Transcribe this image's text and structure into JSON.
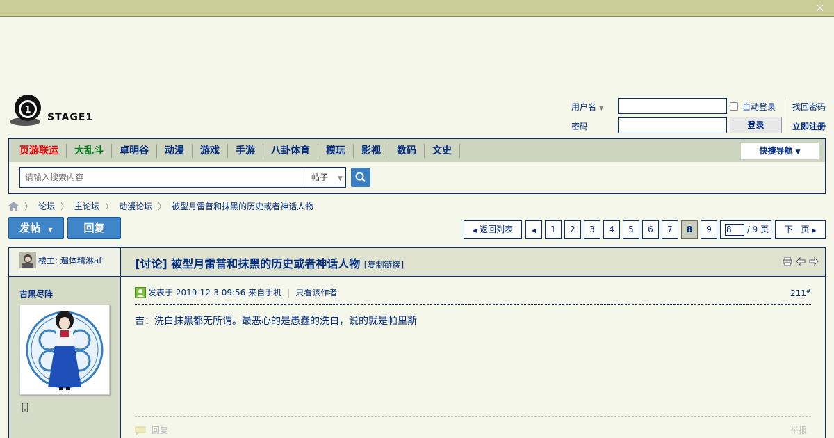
{
  "header": {
    "close_icon": "close-x-icon",
    "logo_text": "STAGE1"
  },
  "login": {
    "username_label": "用户名",
    "password_label": "密码",
    "auto_login_label": "自动登录",
    "login_button": "登录",
    "find_password": "找回密码",
    "register": "立即注册"
  },
  "nav": {
    "items": [
      {
        "label": "页游联运",
        "color": "#e60000"
      },
      {
        "label": "大乱斗",
        "color": "#00811a"
      },
      {
        "label": "卓明谷"
      },
      {
        "label": "动漫"
      },
      {
        "label": "游戏"
      },
      {
        "label": "手游"
      },
      {
        "label": "八卦体育"
      },
      {
        "label": "模玩"
      },
      {
        "label": "影视"
      },
      {
        "label": "数码"
      },
      {
        "label": "文史"
      }
    ],
    "quick_nav": "快捷导航"
  },
  "search": {
    "placeholder": "请输入搜索内容",
    "type": "帖子"
  },
  "breadcrumb": {
    "items": [
      "论坛",
      "主论坛",
      "动漫论坛",
      "被型月雷普和抹黑的历史或者神话人物"
    ]
  },
  "actions": {
    "new_post": "发帖",
    "reply": "回复"
  },
  "pagination": {
    "back": "返回列表",
    "pages": [
      "1",
      "2",
      "3",
      "4",
      "5",
      "6",
      "7",
      "8",
      "9"
    ],
    "current": "8",
    "input_value": "8",
    "total": "/ 9 页",
    "next": "下一页"
  },
  "post": {
    "op_label": "楼主: 遍体精淋af",
    "author": "吉黑尽阵",
    "title": "[讨论] 被型月雷普和抹黑的历史或者神话人物",
    "copy_link": "[复制链接]",
    "posted_at": "发表于 2019-12-3 09:56 来自手机",
    "only_author": "只看该作者",
    "floor": "211",
    "floor_sup": "#",
    "content": "吉：洗白抹黑都无所谓。最恶心的是愚蠢的洗白，说的就是帕里斯",
    "reply": "回复",
    "report": "举报"
  }
}
